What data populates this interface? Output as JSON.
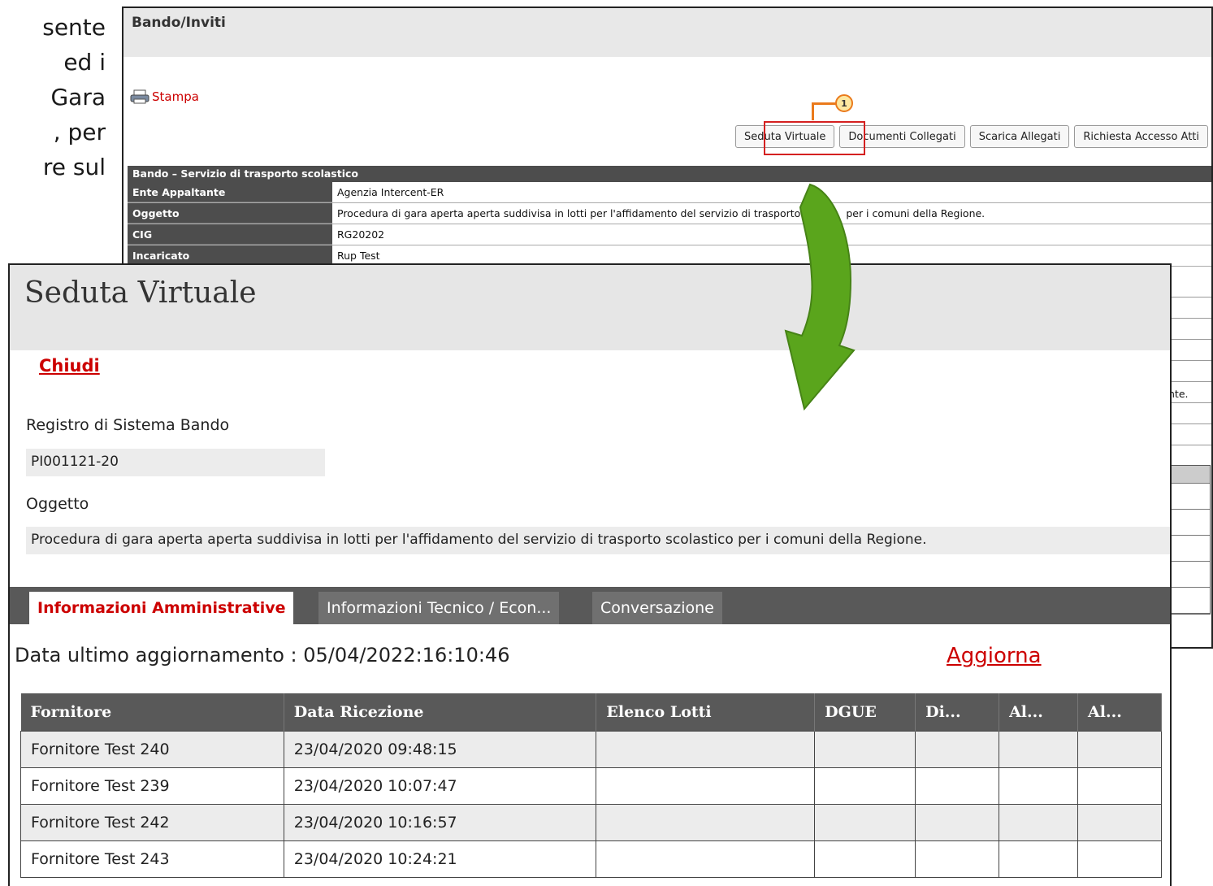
{
  "left_text": {
    "lines": [
      "sente",
      "ed i",
      "Gara",
      ", per",
      "re sul"
    ]
  },
  "background_window": {
    "title": "Bando/Inviti",
    "stampa_label": "Stampa",
    "buttons": [
      "Seduta Virtuale",
      "Documenti Collegati",
      "Scarica Allegati",
      "Richiesta Accesso Atti"
    ],
    "callout_number": "1",
    "section_title": "Bando – Servizio di trasporto scolastico",
    "rows": [
      {
        "label": "Ente Appaltante",
        "value": "Agenzia Intercent-ER"
      },
      {
        "label": "Oggetto",
        "value": "Procedura di gara aperta aperta suddivisa in lotti per l'affidamento del servizio di trasporto scola     per i comuni della Regione."
      },
      {
        "label": "CIG",
        "value": "RG20202"
      },
      {
        "label": "Incaricato",
        "value": "Rup Test"
      }
    ],
    "right_fragment": "nte."
  },
  "seduta": {
    "title": "Seduta Virtuale",
    "chiudi": "Chiudi",
    "registro_label": "Registro di Sistema Bando",
    "registro_value": "PI001121-20",
    "oggetto_label": "Oggetto",
    "oggetto_value": "Procedura di gara aperta aperta suddivisa in lotti per l'affidamento del servizio di trasporto scolastico per i comuni della Regione.",
    "tabs": [
      "Informazioni Amministrative",
      "Informazioni Tecnico / Econ...",
      "Conversazione"
    ],
    "update_text": "Data ultimo aggiornamento : 05/04/2022:16:10:46",
    "aggiorna": "Aggiorna",
    "table": {
      "headers": [
        "Fornitore",
        "Data Ricezione",
        "Elenco Lotti",
        "DGUE",
        "Di...",
        "Al...",
        "Al..."
      ],
      "rows": [
        [
          "Fornitore Test 240",
          "23/04/2020 09:48:15"
        ],
        [
          "Fornitore Test 239",
          "23/04/2020 10:07:47"
        ],
        [
          "Fornitore Test 242",
          "23/04/2020 10:16:57"
        ],
        [
          "Fornitore Test 243",
          "23/04/2020 10:24:21"
        ]
      ]
    }
  },
  "colors": {
    "accent_red": "#cc0000",
    "callout_orange": "#ea7a1c",
    "arrow_green": "#5aa51c",
    "header_gray": "#595959"
  }
}
